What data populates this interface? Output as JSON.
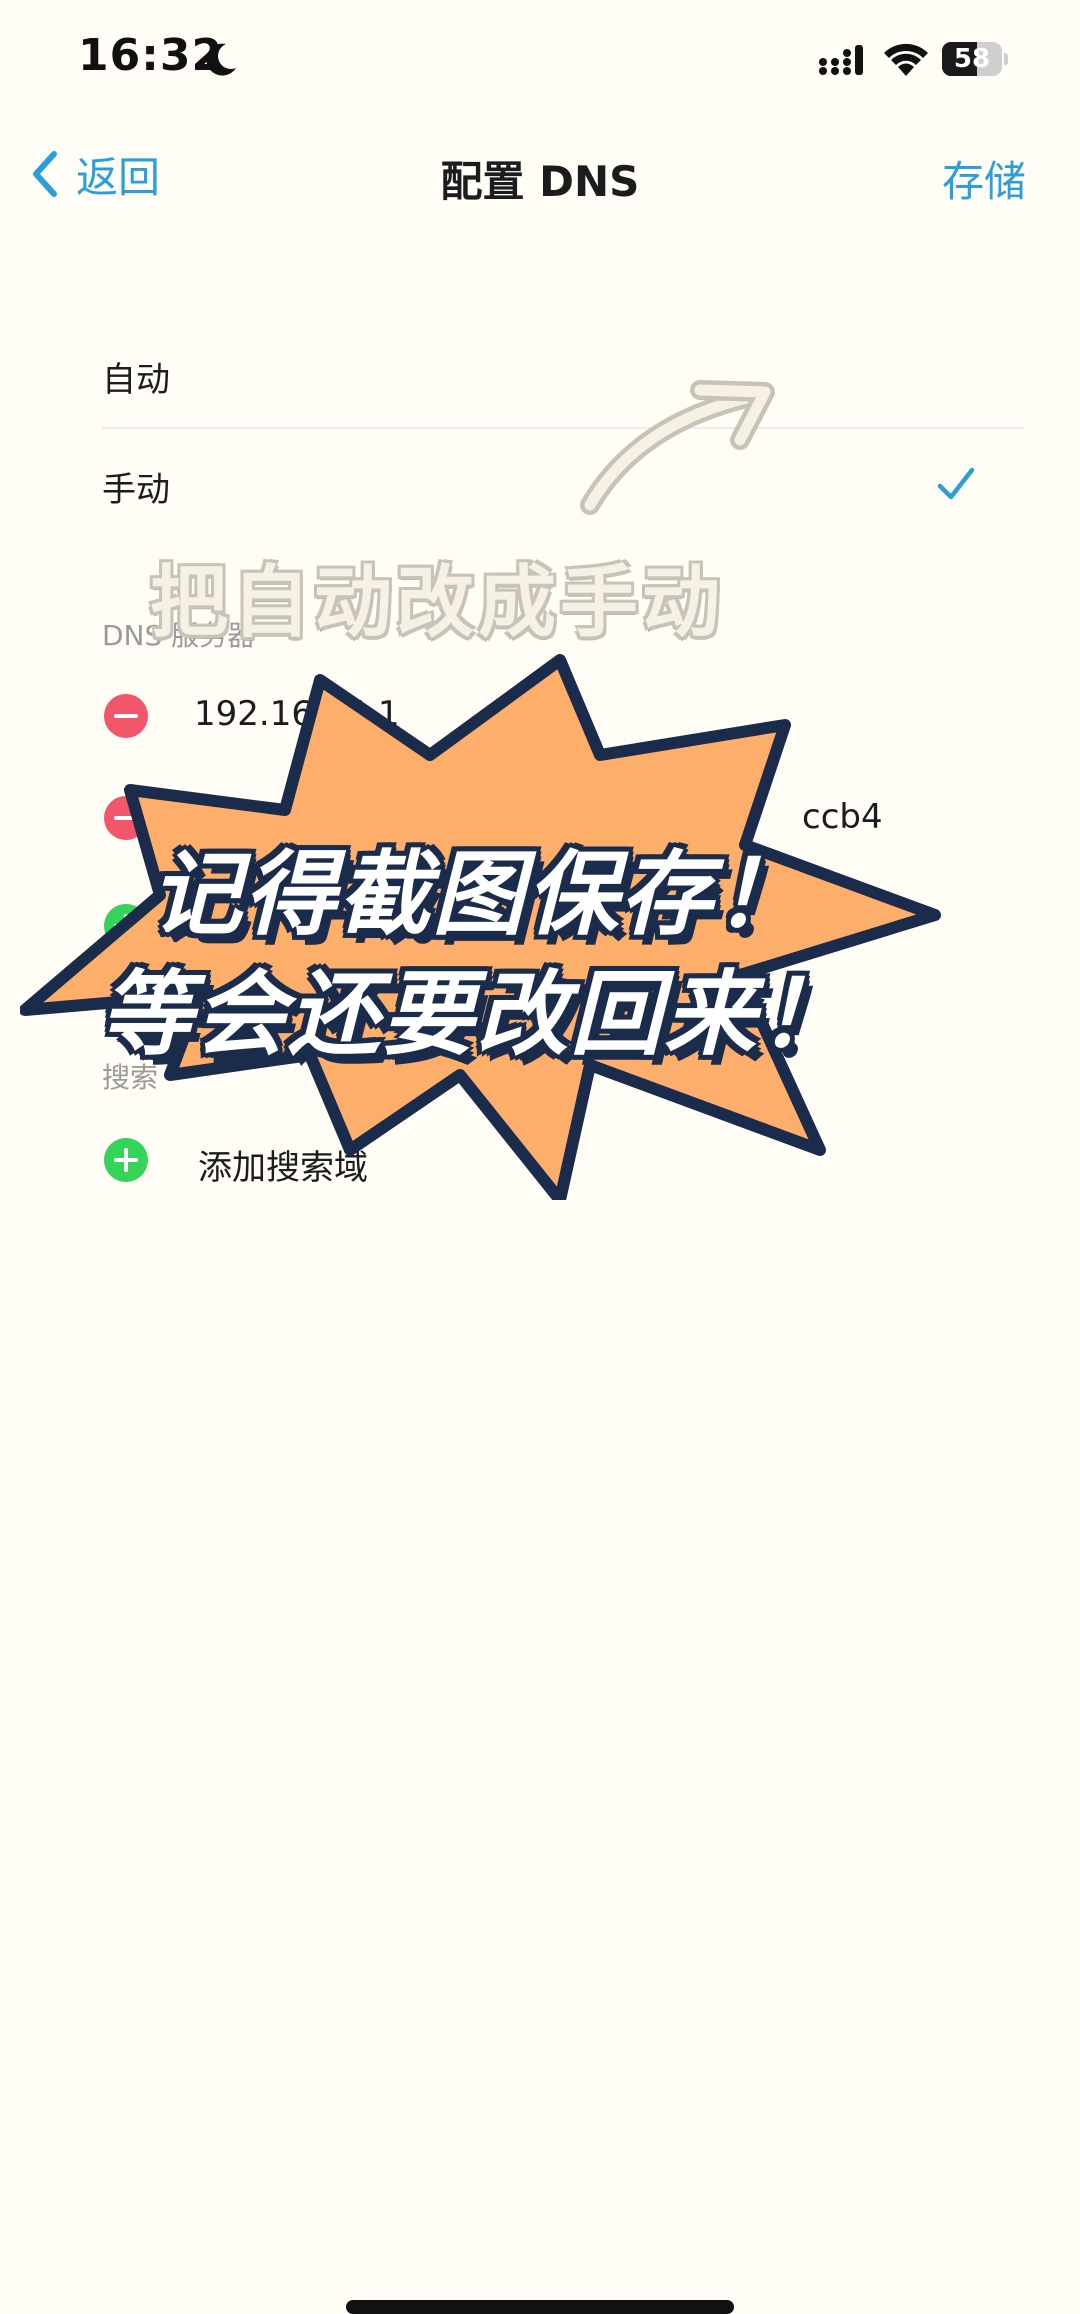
{
  "status_bar": {
    "time": "16:32",
    "battery_text": "58",
    "battery_level": 0.58,
    "icons": [
      "moon-icon",
      "signal-icon",
      "wifi-icon",
      "battery-icon"
    ]
  },
  "nav": {
    "back_label": "返回",
    "title": "配置 DNS",
    "save_label": "存储"
  },
  "mode_options": [
    {
      "label": "自动",
      "selected": false
    },
    {
      "label": "手动",
      "selected": true
    }
  ],
  "dns_section": {
    "header": "DNS 服务器",
    "servers": [
      "192.168.4.1",
      "ccb4"
    ]
  },
  "search_section": {
    "header": "搜索",
    "add_label": "添加搜索域"
  },
  "annotation": {
    "handwritten": "把自动改成手动",
    "burst_line1": "记得截图保存！",
    "burst_line2": "等会还要改回来！"
  },
  "colors": {
    "accent": "#2a9fd8",
    "minus": "#f2566b",
    "plus": "#36d35a",
    "burst_fill": "#fdae6b",
    "burst_outline": "#1b2b4b",
    "background": "#fffdf6"
  }
}
